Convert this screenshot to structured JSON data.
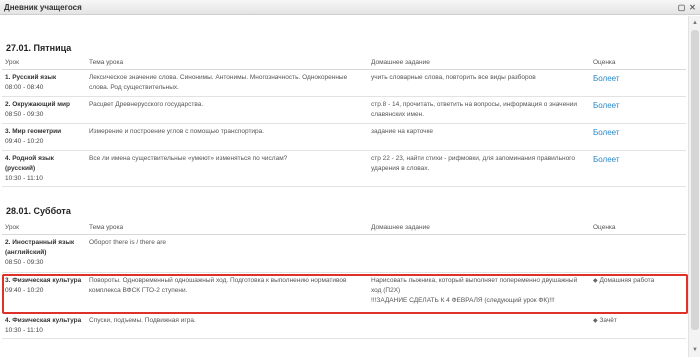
{
  "window": {
    "title": "Дневник учащегося"
  },
  "columns": {
    "lesson": "Урок",
    "topic": "Тема урока",
    "homework": "Домашнее задание",
    "grade": "Оценка"
  },
  "days": [
    {
      "heading": "27.01. Пятница",
      "rows": [
        {
          "num_name": "1. Русский язык",
          "time": "08:00 - 08:40",
          "topic": "Лексическое значение слова. Синонимы. Антонимы. Многозначность. Однокоренные слова. Род существительных.",
          "homework": "учить словарные слова, повторить все виды разборов",
          "grade": "Болеет"
        },
        {
          "num_name": "2. Окружающий мир",
          "time": "08:50 - 09:30",
          "topic": "Расцвет Древнерусского государства.",
          "homework": "стр.8 - 14, прочитать, ответить на вопросы, информация о значении славянских имен.",
          "grade": "Болеет"
        },
        {
          "num_name": "3. Мир геометрии",
          "time": "09:40 - 10:20",
          "topic": "Измерение и построение углов с помощью транспортира.",
          "homework": "задание на карточке",
          "grade": "Болеет"
        },
        {
          "num_name": "4. Родной язык (русский)",
          "time": "10:30 - 11:10",
          "topic": "Все ли имена существительные «умеют» изменяться по числам?",
          "homework": "стр 22 - 23, найти стихи - рифмовки, для запоминания правильного ударения в словах.",
          "grade": "Болеет"
        }
      ]
    },
    {
      "heading": "28.01. Суббота",
      "rows": [
        {
          "num_name": "2. Иностранный язык (английский)",
          "time": "08:50 - 09:30",
          "topic": "Оборот there is / there are",
          "homework": "",
          "grade": ""
        },
        {
          "num_name": "3. Физическая культура",
          "time": "09:40 - 10:20",
          "topic": "Повороты. Одновременный одношажный ход. Подготовка к выполнению нормативов комплекса ВФСК ГТО-2 ступени.",
          "homework": "Нарисовать лыжника, который выполняет попеременно двушажный ход (П2Х)",
          "homework_note": "!!!ЗАДАНИЕ СДЕЛАТЬ К 4 ФЕВРАЛЯ (следующий урок ФК)!!!",
          "grade": "Домашняя работа"
        },
        {
          "num_name": "4. Физическая культура",
          "time": "10:30 - 11:10",
          "topic": "Спуски, подъемы. Подвижная игра.",
          "homework": "",
          "grade": "Зачёт"
        }
      ]
    }
  ],
  "icons": {
    "max": "maximize-icon",
    "close": "close-icon",
    "tag": "tag-icon"
  },
  "colors": {
    "link": "#2a88c8",
    "highlight": "#e0302a"
  }
}
